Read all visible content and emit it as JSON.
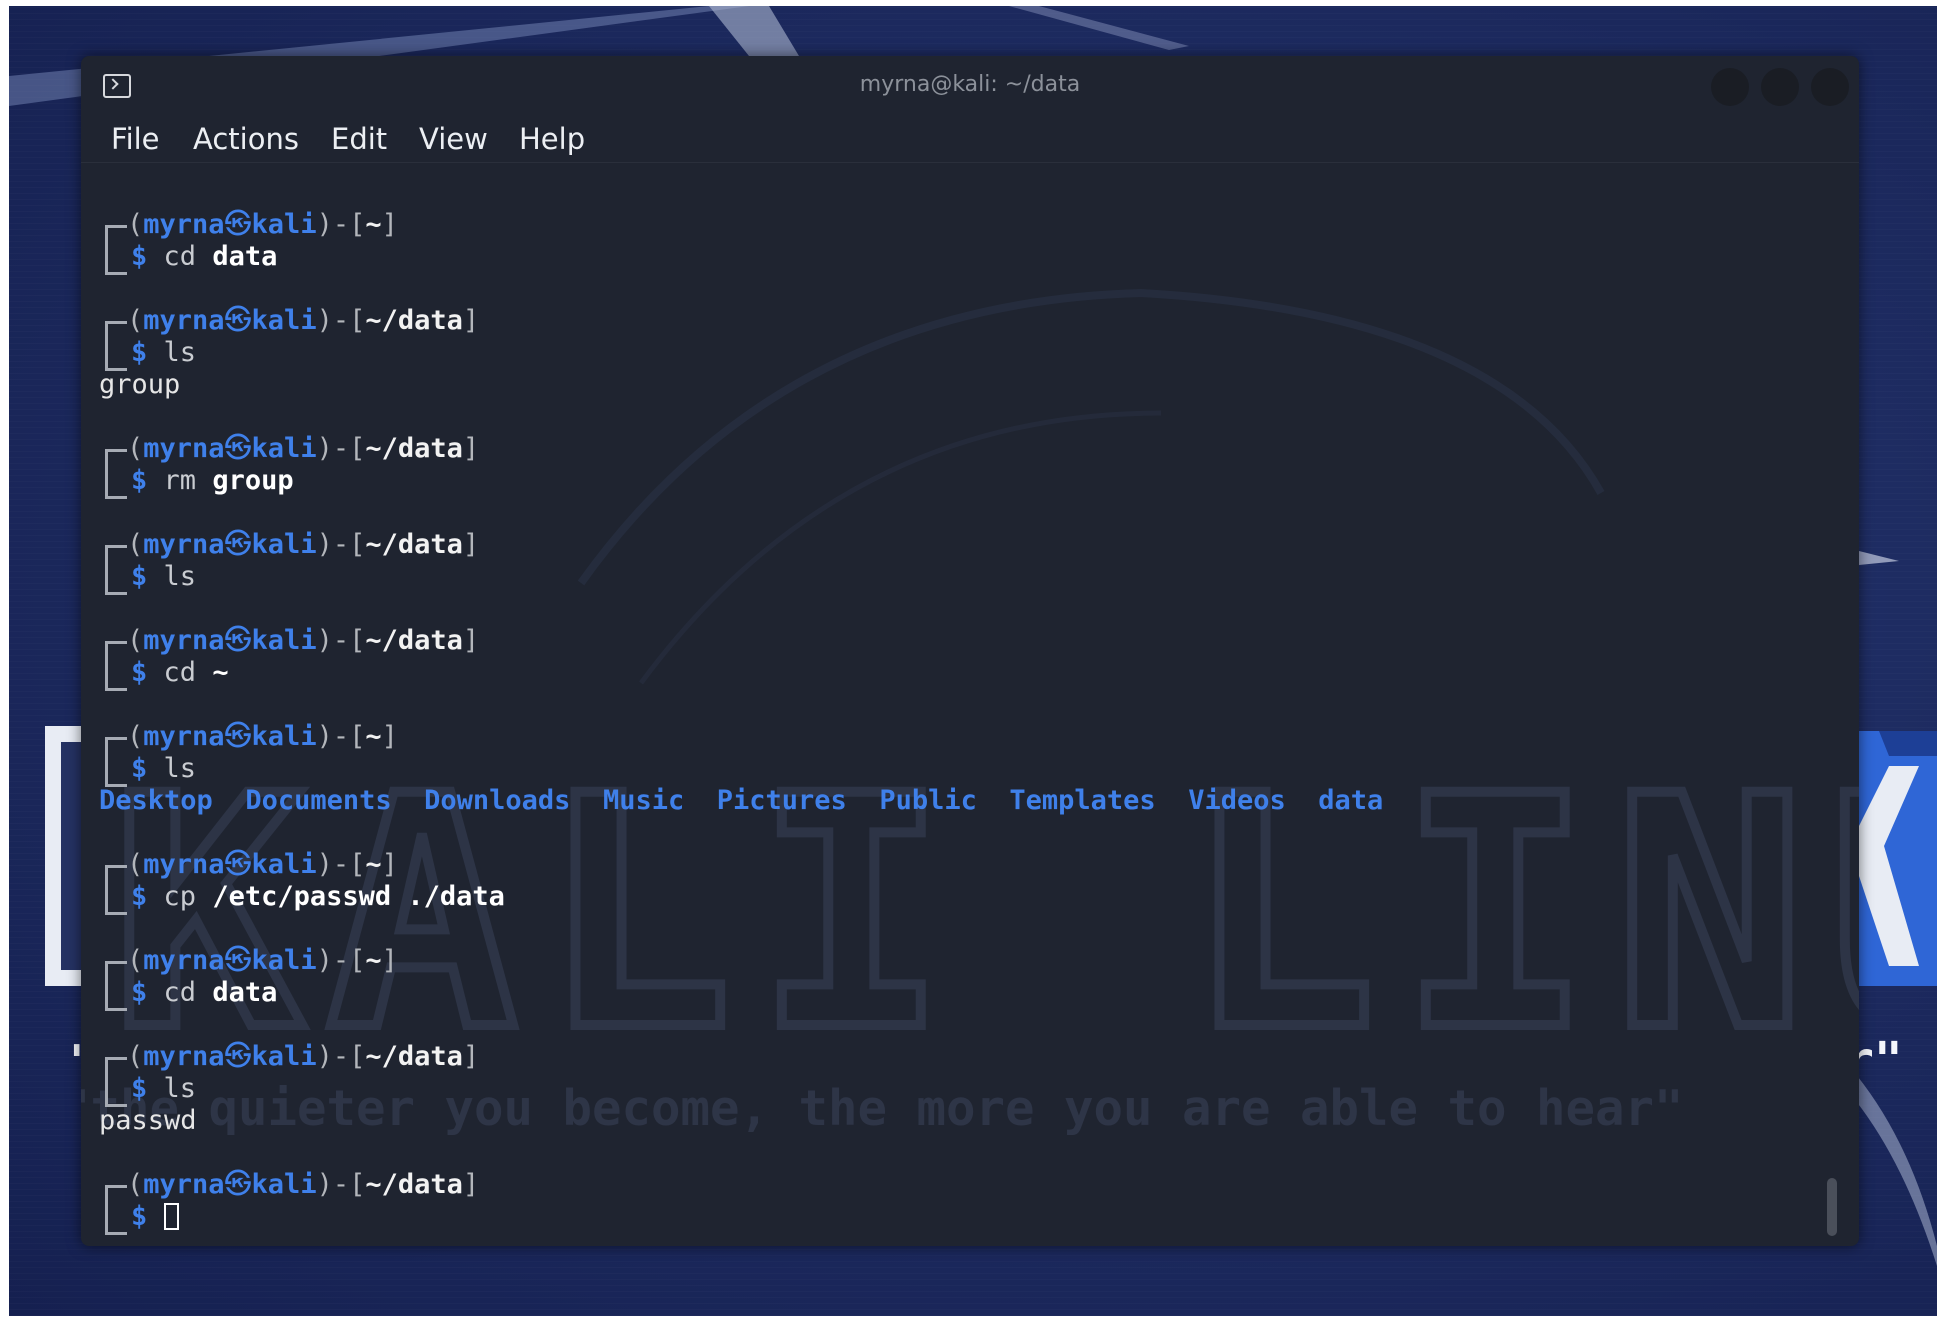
{
  "window": {
    "title": "myrna@kali: ~/data",
    "icon": "terminal-icon"
  },
  "menu": [
    {
      "label": "File"
    },
    {
      "label": "Actions"
    },
    {
      "label": "Edit"
    },
    {
      "label": "View"
    },
    {
      "label": "Help"
    }
  ],
  "prompt": {
    "open": "(",
    "user": "myrna",
    "at_symbol": "㉿",
    "host": "kali",
    "mid": ")-[",
    "close": "]",
    "dollar": "$"
  },
  "session": [
    {
      "path": "~",
      "cmd": "cd",
      "args": "data",
      "output": []
    },
    {
      "path": "~/data",
      "cmd": "ls",
      "args": "",
      "output": [
        "group"
      ]
    },
    {
      "path": "~/data",
      "cmd": "rm",
      "args": "group",
      "output": []
    },
    {
      "path": "~/data",
      "cmd": "ls",
      "args": "",
      "output": []
    },
    {
      "path": "~/data",
      "cmd": "cd",
      "args": "~",
      "output": []
    },
    {
      "path": "~",
      "cmd": "ls",
      "args": "",
      "dirs": [
        "Desktop",
        "Documents",
        "Downloads",
        "Music",
        "Pictures",
        "Public",
        "Templates",
        "Videos",
        "data"
      ]
    },
    {
      "path": "~",
      "cmd": "cp",
      "args": "/etc/passwd ./data",
      "output": []
    },
    {
      "path": "~",
      "cmd": "cd",
      "args": "data",
      "output": []
    },
    {
      "path": "~/data",
      "cmd": "ls",
      "args": "",
      "output": [
        "passwd"
      ]
    },
    {
      "path": "~/data",
      "cmd": "",
      "args": "",
      "output": [],
      "active": true
    }
  ],
  "wallpaper": {
    "logo_text": "KALI LINUX",
    "quote": "\"the quieter you become, the more you are able to hear\""
  },
  "colors": {
    "terminal_bg": "#1f2430",
    "accent_blue": "#3f80ea",
    "text": "#e6e6e6"
  }
}
